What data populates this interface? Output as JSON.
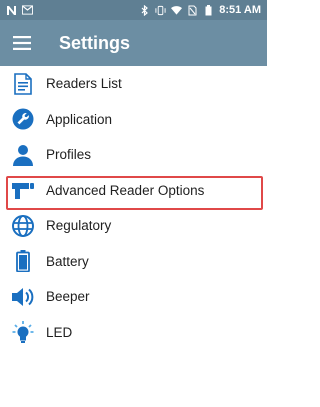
{
  "status_bar": {
    "left_icons": [
      "n-icon",
      "gmail-icon"
    ],
    "right_icons": [
      "bluetooth-icon",
      "vibrate-icon",
      "wifi-icon",
      "no-sim-icon",
      "battery-icon"
    ],
    "time": "8:51 AM"
  },
  "app_bar": {
    "title": "Settings"
  },
  "menu": {
    "items": [
      {
        "label": "Readers List",
        "icon": "document-icon"
      },
      {
        "label": "Application",
        "icon": "wrench-icon"
      },
      {
        "label": "Profiles",
        "icon": "person-icon"
      },
      {
        "label": "Advanced Reader Options",
        "icon": "handheld-reader-icon",
        "highlighted": true
      },
      {
        "label": "Regulatory",
        "icon": "globe-icon"
      },
      {
        "label": "Battery",
        "icon": "battery-icon"
      },
      {
        "label": "Beeper",
        "icon": "speaker-icon"
      },
      {
        "label": "LED",
        "icon": "lightbulb-icon"
      }
    ]
  },
  "colors": {
    "status_bar": "#5f7f93",
    "app_bar": "#6c8ea3",
    "icon_blue": "#1a6fc0",
    "highlight_border": "#e04848"
  }
}
